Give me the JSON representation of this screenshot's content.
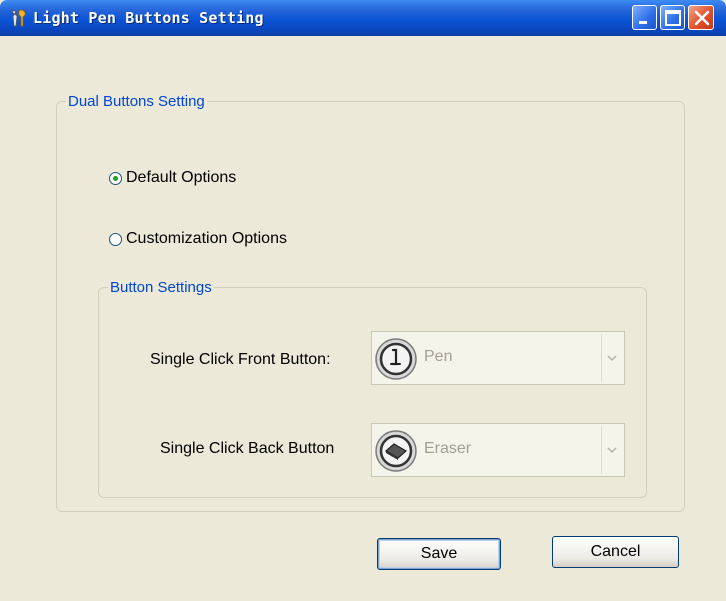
{
  "window": {
    "title": "Light Pen Buttons Setting",
    "icon": "tools-icon",
    "controls": [
      "minimize-icon",
      "maximize-icon",
      "close-icon"
    ]
  },
  "dual_group": {
    "legend": "Dual Buttons Setting",
    "radio_default": {
      "label": "Default Options",
      "checked": true
    },
    "radio_custom": {
      "label": "Customization Options",
      "checked": false
    }
  },
  "button_group": {
    "legend": "Button Settings",
    "front": {
      "label": "Single Click Front Button:",
      "value": "Pen",
      "icon": "pen-icon",
      "enabled": false
    },
    "back": {
      "label": "Single Click Back Button",
      "value": "Eraser",
      "icon": "eraser-icon",
      "enabled": false
    }
  },
  "actions": {
    "save": "Save",
    "cancel": "Cancel"
  },
  "colors": {
    "titlebar": "#0a55d6",
    "legend_text": "#0046d5",
    "dialog_bg": "#ece9d8",
    "disabled_text": "#a19f93"
  }
}
